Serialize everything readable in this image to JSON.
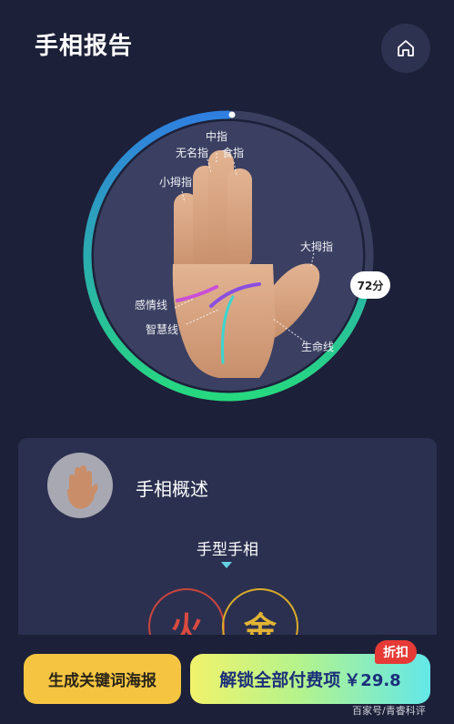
{
  "header": {
    "title": "手相报告",
    "home_icon": "home-icon"
  },
  "palm": {
    "labels": {
      "middle": "中指",
      "ring": "无名指",
      "index": "食指",
      "little": "小拇指",
      "thumb": "大拇指",
      "heart_line": "感情线",
      "head_line": "智慧线",
      "life_line": "生命线"
    },
    "score": "72分",
    "score_fraction": 0.72
  },
  "overview": {
    "title": "手相概述",
    "hand_type_title": "手型手相",
    "elements": [
      "火",
      "金"
    ]
  },
  "actions": {
    "poster_label": "生成关键词海报",
    "unlock_label": "解锁全部付费项",
    "price": "￥29.8",
    "discount_badge": "折扣"
  },
  "watermark": "百家号/青睿科评",
  "colors": {
    "background": "#1c2038",
    "card": "#2b3050",
    "ring_start": "#2f7fe0",
    "ring_end": "#26d97f",
    "fire": "#d94a3f",
    "metal": "#e2b434",
    "badge": "#e53a35"
  }
}
